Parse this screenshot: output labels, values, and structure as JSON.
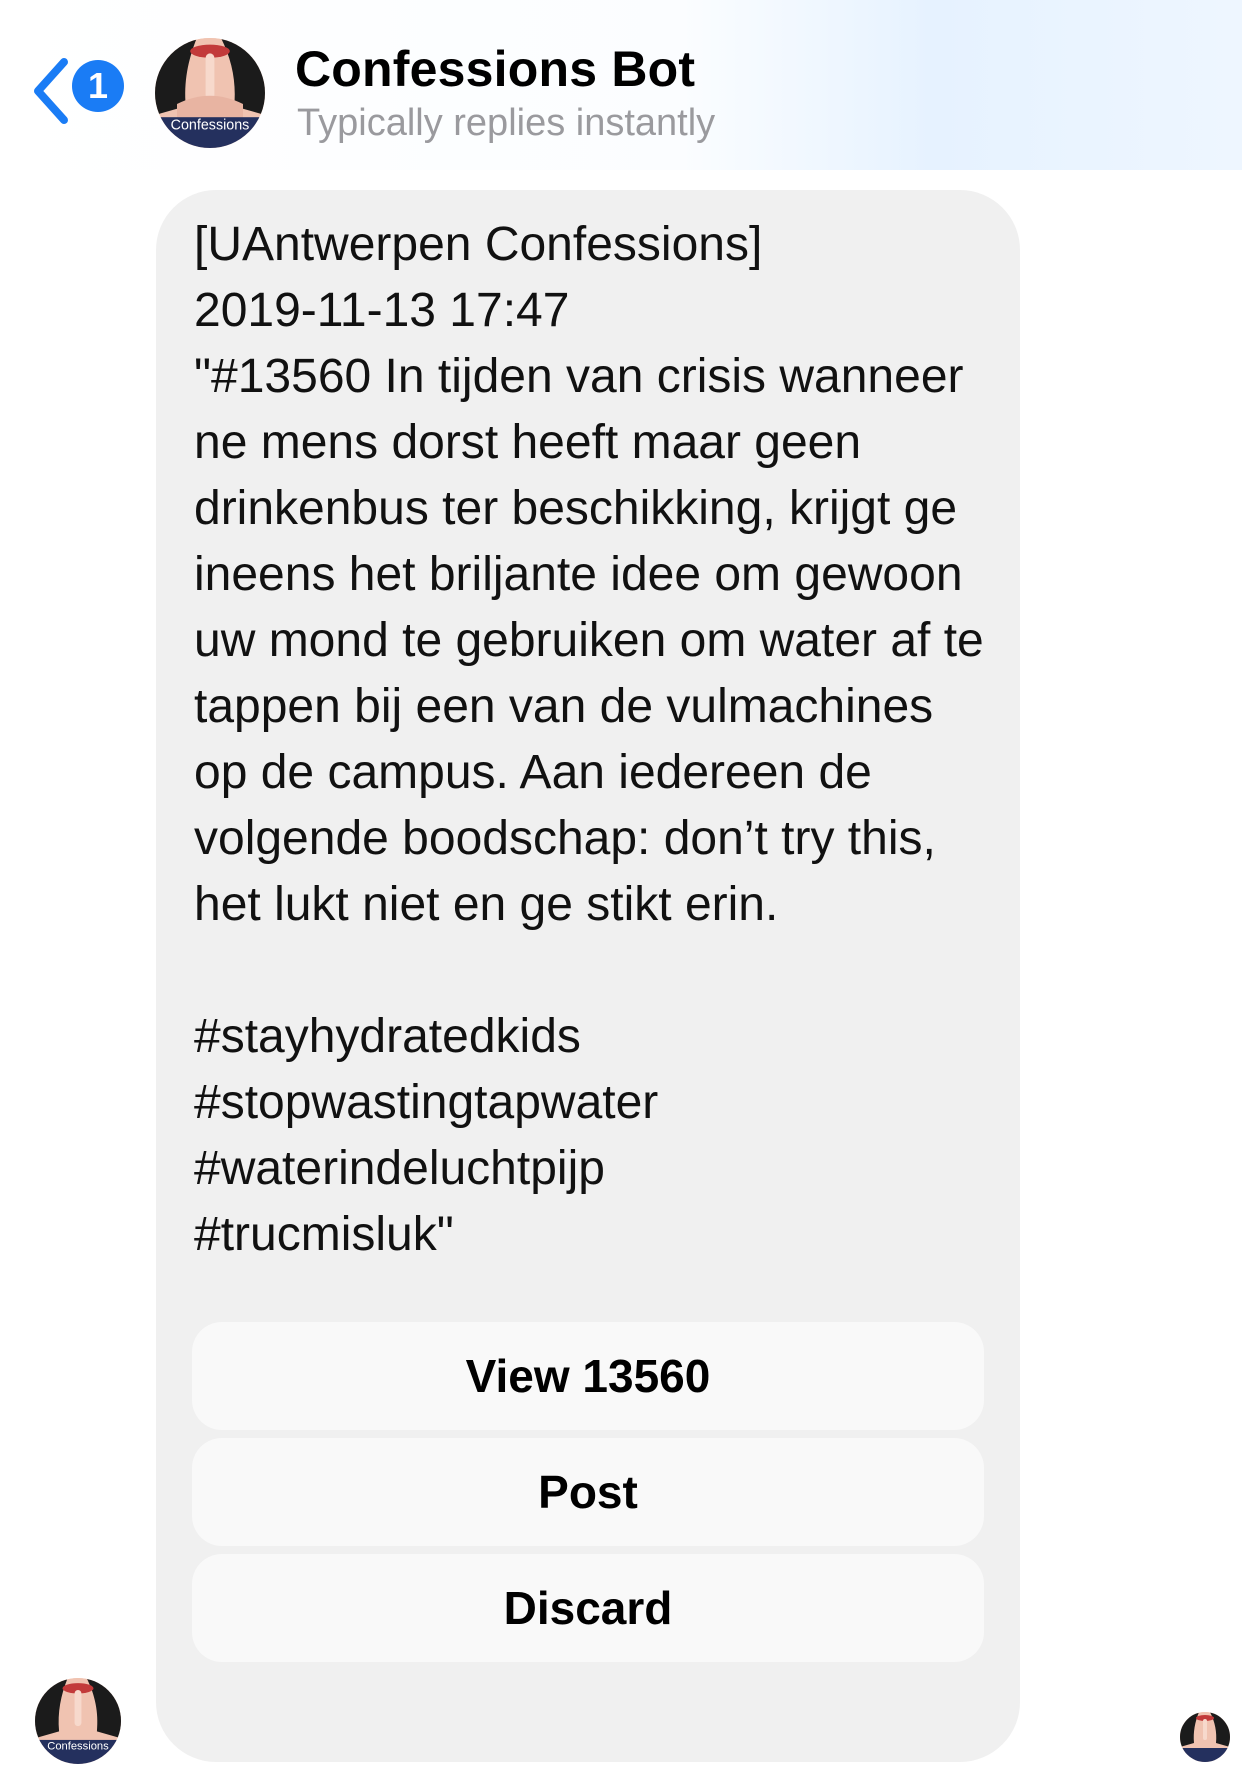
{
  "header": {
    "back_badge_count": "1",
    "title": "Confessions Bot",
    "subtitle": "Typically replies instantly"
  },
  "avatar": {
    "label": "Confessions"
  },
  "message": {
    "text": "[UAntwerpen Confessions]\n2019-11-13 17:47\n\"#13560 In tijden van crisis wanneer ne mens dorst heeft maar geen drinkenbus ter beschikking, krijgt ge ineens het briljante idee om gewoon uw mond te gebruiken om water af te tappen bij een van de vulmachines op de campus. Aan iedereen de volgende boodschap: don’t try this, het lukt niet en ge stikt erin.\n\n#stayhydratedkids\n#stopwastingtapwater\n#waterindeluchtpijp\n#trucmisluk\""
  },
  "buttons": {
    "view": "View 13560",
    "post": "Post",
    "discard": "Discard"
  },
  "colors": {
    "accent": "#1a7cf5",
    "bubble": "#f0f0f0",
    "button": "#f9f9f9",
    "subtitle": "#9a9a9e"
  },
  "icons": {
    "back": "chevron-left-icon",
    "avatar": "confessions-avatar-icon"
  }
}
